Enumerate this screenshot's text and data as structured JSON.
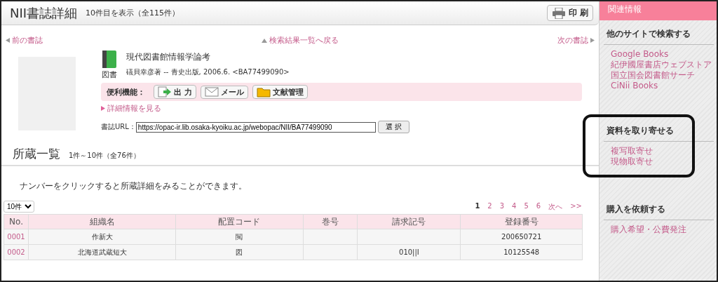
{
  "header": {
    "title": "NII書誌詳細",
    "subtitle": "10件目を表示（全115件）",
    "print_button": "印 刷"
  },
  "nav": {
    "prev": "前の書誌",
    "back": "検索結果一覧へ戻る",
    "next": "次の書誌"
  },
  "book": {
    "title": "現代図書館情報学論考",
    "type_label": "図書",
    "details": "礒貝幸彦著 -- 青史出版, 2006.6. <BA77499090>",
    "tools_label": "便利機能：",
    "tools": [
      {
        "kind": "export",
        "label": "出 力"
      },
      {
        "kind": "mail",
        "label": "メール"
      },
      {
        "kind": "folder",
        "label": "文献管理"
      }
    ],
    "more_link": "詳細情報を見る",
    "url_label": "書誌URL：",
    "url": "https://opac-ir.lib.osaka-kyoiku.ac.jp/webopac/NII/BA77499090",
    "select_button": "選 択"
  },
  "holdings": {
    "title": "所蔵一覧",
    "subtitle": "1件～10件（全76件）",
    "note": "ナンバーをクリックすると所蔵詳細をみることができます。",
    "per_page": "10件",
    "pages": [
      {
        "label": "1",
        "selected": true
      },
      {
        "label": "2",
        "selected": false
      },
      {
        "label": "3",
        "selected": false
      },
      {
        "label": "4",
        "selected": false
      },
      {
        "label": "5",
        "selected": false
      },
      {
        "label": "6",
        "selected": false
      },
      {
        "label": "次へ",
        "selected": false
      },
      {
        "label": ">>",
        "selected": false
      }
    ],
    "columns": [
      "No.",
      "組織名",
      "配置コード",
      "巻号",
      "請求記号",
      "登録番号"
    ],
    "rows": [
      [
        "0001",
        "作新大",
        "閲",
        "",
        "",
        "200650721"
      ],
      [
        "0002",
        "北海道武蔵短大",
        "図",
        "",
        "010||I",
        "10125548"
      ]
    ]
  },
  "sidebar": {
    "title": "関連情報",
    "sections": [
      {
        "heading": "他のサイトで検索する",
        "highlighted": false,
        "links": [
          "Google Books",
          "紀伊國屋書店ウェブストア",
          "国立国会図書館サーチ",
          "CiNii Books"
        ]
      },
      {
        "heading": "資料を取り寄せる",
        "highlighted": true,
        "links": [
          "複写取寄せ",
          "現物取寄せ"
        ]
      },
      {
        "heading": "購入を依頼する",
        "highlighted": false,
        "links": [
          "購入希望・公費発注"
        ]
      }
    ]
  }
}
